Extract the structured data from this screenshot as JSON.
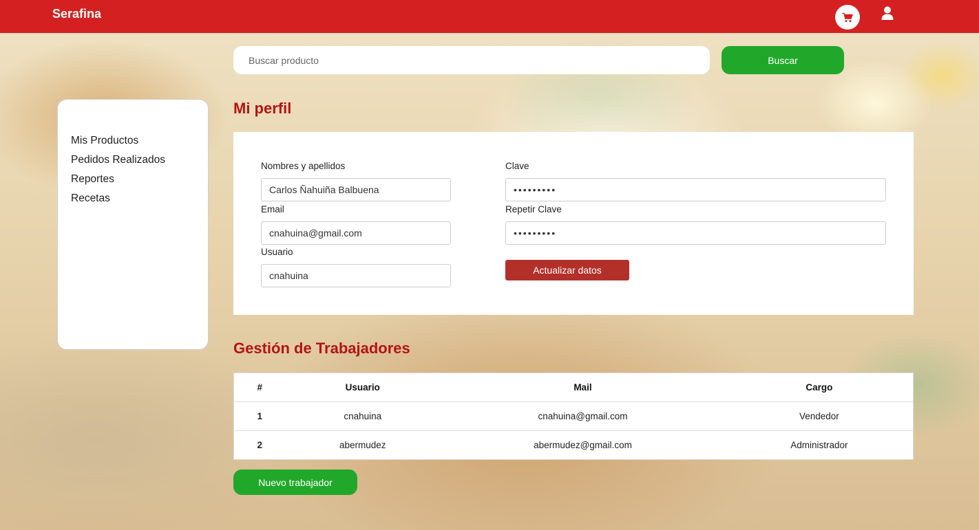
{
  "header": {
    "brand": "Serafina",
    "cart_icon": "cart-icon",
    "user_icon": "user-icon"
  },
  "search": {
    "placeholder": "Buscar producto",
    "button_label": "Buscar"
  },
  "sidebar": {
    "items": [
      {
        "label": "Mis Productos"
      },
      {
        "label": "Pedidos Realizados"
      },
      {
        "label": "Reportes"
      },
      {
        "label": "Recetas"
      }
    ]
  },
  "profile": {
    "title": "Mi perfil",
    "fields": {
      "name_label": "Nombres y apellidos",
      "name_value": "Carlos Ñahuiña Balbuena",
      "email_label": "Email",
      "email_value": "cnahuina@gmail.com",
      "user_label": "Usuario",
      "user_value": "cnahuina",
      "password_label": "Clave",
      "password_value": "•••••••••",
      "repeat_password_label": "Repetir Clave",
      "repeat_password_value": "•••••••••"
    },
    "update_button": "Actualizar datos"
  },
  "workers": {
    "title": "Gestión de Trabajadores",
    "columns": [
      "#",
      "Usuario",
      "Mail",
      "Cargo"
    ],
    "rows": [
      {
        "num": "1",
        "user": "cnahuina",
        "mail": "cnahuina@gmail.com",
        "role": "Vendedor"
      },
      {
        "num": "2",
        "user": "abermudez",
        "mail": "abermudez@gmail.com",
        "role": "Administrador"
      }
    ],
    "new_button": "Nuevo trabajador"
  },
  "colors": {
    "header": "#d42020",
    "accent_green": "#21a82a",
    "title_red": "#b51414",
    "update_button": "#b3302a"
  }
}
